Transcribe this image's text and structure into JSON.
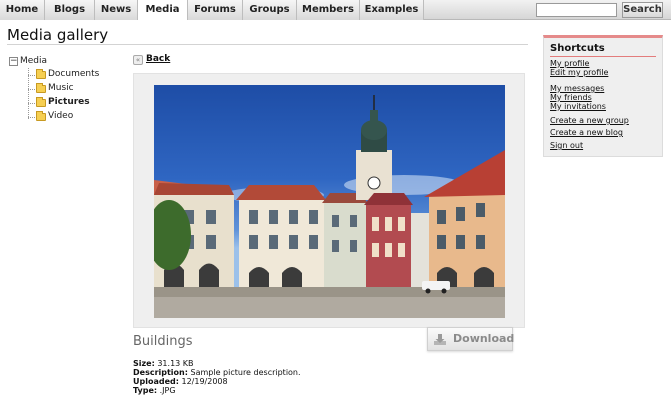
{
  "nav": {
    "tabs": [
      {
        "label": "Home"
      },
      {
        "label": "Blogs"
      },
      {
        "label": "News"
      },
      {
        "label": "Media"
      },
      {
        "label": "Forums"
      },
      {
        "label": "Groups"
      },
      {
        "label": "Members"
      },
      {
        "label": "Examples"
      }
    ],
    "active_tab": "Media",
    "search": {
      "value": "",
      "button_label": "Search"
    }
  },
  "page": {
    "title": "Media gallery"
  },
  "tree": {
    "root": {
      "label": "Media",
      "toggle": "−"
    },
    "items": [
      {
        "label": "Documents"
      },
      {
        "label": "Music"
      },
      {
        "label": "Pictures"
      },
      {
        "label": "Video"
      }
    ],
    "selected": "Pictures"
  },
  "viewer": {
    "back_label": "Back",
    "download_label": "Download",
    "photo_title": "Buildings",
    "details": {
      "size_label": "Size:",
      "size_value": "31.13 KB",
      "description_label": "Description:",
      "description_value": "Sample picture description.",
      "uploaded_label": "Uploaded:",
      "uploaded_value": "12/19/2008",
      "type_label": "Type:",
      "type_value": ".JPG"
    }
  },
  "shortcuts": {
    "title": "Shortcuts",
    "links": [
      {
        "label": "My profile"
      },
      {
        "label": "Edit my profile"
      },
      {
        "label": "My messages"
      },
      {
        "label": "My friends"
      },
      {
        "label": "My invitations"
      },
      {
        "label": "Create a new group"
      },
      {
        "label": "Create a new blog"
      },
      {
        "label": "Sign out"
      }
    ]
  },
  "colors": {
    "accent_red": "#e58a8a",
    "nav_bg": "#d9d9d9",
    "panel_bg": "#efefef",
    "sky": "#2f66c2"
  },
  "icons": [
    "tree-collapse-icon",
    "folder-icon",
    "back-arrow-icon",
    "download-icon"
  ]
}
